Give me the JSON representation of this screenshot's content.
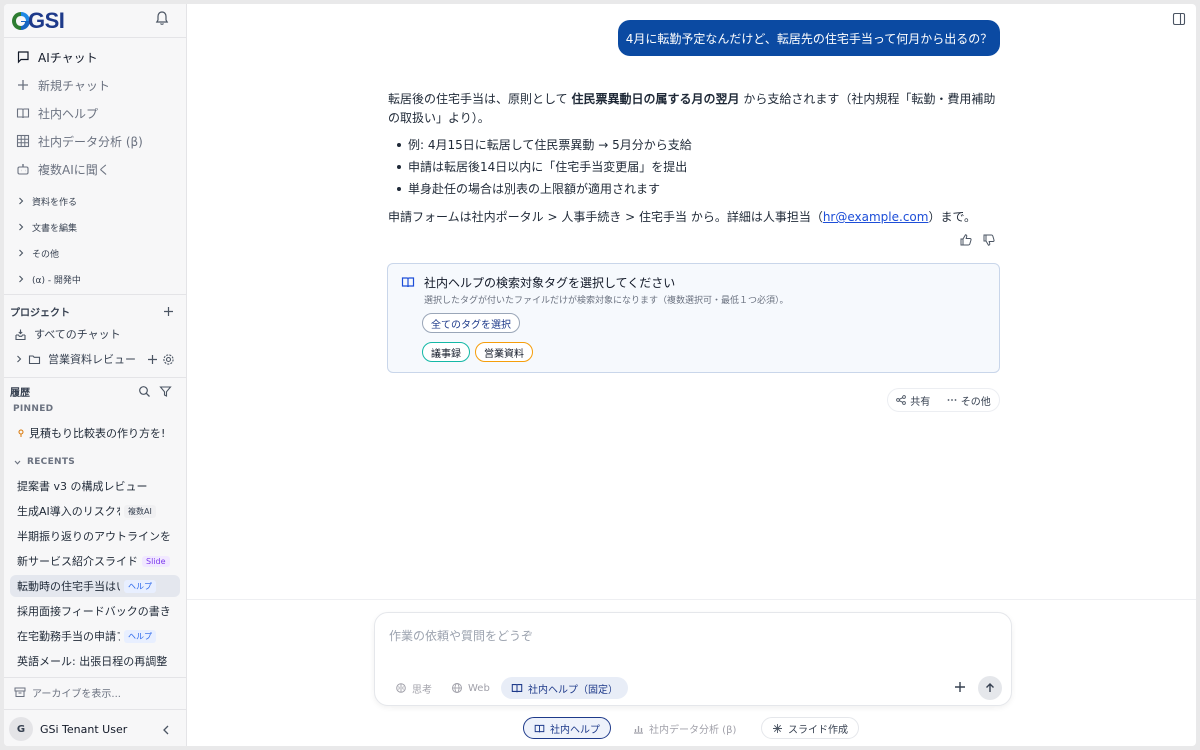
{
  "brand": {
    "logo_text": "GSI"
  },
  "nav": {
    "items": [
      {
        "label": "AIチャット",
        "icon": "chat-icon"
      },
      {
        "label": "新規チャット",
        "icon": "plus-icon"
      },
      {
        "label": "社内ヘルプ",
        "icon": "book-icon"
      },
      {
        "label": "社内データ分析 (β)",
        "icon": "grid-icon"
      },
      {
        "label": "複数AIに聞く",
        "icon": "robot-icon"
      }
    ],
    "sections": [
      "資料を作る",
      "文書を編集",
      "その他",
      "(α) - 開発中"
    ]
  },
  "projects": {
    "heading": "プロジェクト",
    "all_chats": "すべてのチャット",
    "folder": "営業資料レビュー"
  },
  "history": {
    "heading": "履歴",
    "pinned_label": "PINNED",
    "pinned": [
      {
        "title": "見積もり比較表の作り方を!"
      }
    ],
    "recents_label": "RECENTS",
    "recents": [
      {
        "title": "提案書 v3 の構成レビュー",
        "tag": ""
      },
      {
        "title": "生成AI導入のリスクを",
        "tag": "複数AI"
      },
      {
        "title": "半期振り返りのアウトラインを",
        "tag": ""
      },
      {
        "title": "新サービス紹介スライド",
        "tag": "Slide"
      },
      {
        "title": "転動時の住宅手当はい",
        "tag": "ヘルプ"
      },
      {
        "title": "採用面接フィードバックの書き",
        "tag": ""
      },
      {
        "title": "在宅勤務手当の申請フ",
        "tag": "ヘルプ"
      },
      {
        "title": "英語メール: 出張日程の再調整",
        "tag": ""
      }
    ],
    "archive_label": "アーカイブを表示..."
  },
  "user": {
    "initial": "G",
    "name": "GSi Tenant User"
  },
  "conversation": {
    "user_message": "4月に転勤予定なんだけど、転居先の住宅手当って何月から出るの？",
    "answer": {
      "intro_pre": "転居後の住宅手当は、原則として",
      "intro_bold": "住民票異動日の属する月の翌月",
      "intro_post": "から支給されます（社内規程「転勤・費用補助の取扱い」より）。",
      "bullets": [
        "例: 4月15日に転居して住民票異動 → 5月分から支給",
        "申請は転居後14日以内に「住宅手当変更届」を提出",
        "単身赴任の場合は別表の上限額が適用されます"
      ],
      "footer_pre": "申請フォームは社内ポータル > 人事手続き > 住宅手当 から。詳細は人事担当（",
      "footer_link": "hr@example.com",
      "footer_post": "）まで。"
    }
  },
  "tag_selector": {
    "title": "社内ヘルプの検索対象タグを選択してください",
    "description": "選択したタグが付いたファイルだけが検索対象になります（複数選択可・最低１つ必須）。",
    "select_all": "全てのタグを選択",
    "tags": [
      "議事録",
      "営業資料"
    ]
  },
  "message_actions": {
    "share": "共有",
    "more": "その他"
  },
  "composer": {
    "placeholder": "作業の依頼や質問をどうぞ",
    "modes": {
      "think": "思考",
      "web": "Web",
      "help": "社内ヘルプ（固定）"
    }
  },
  "quick_actions": {
    "help": "社内ヘルプ",
    "data": "社内データ分析 (β)",
    "slide": "スライド作成"
  },
  "colors": {
    "accent": "#0b4aa2",
    "brand": "#1e3a8a",
    "teal": "#14b8a6",
    "amber": "#f59e0b"
  }
}
